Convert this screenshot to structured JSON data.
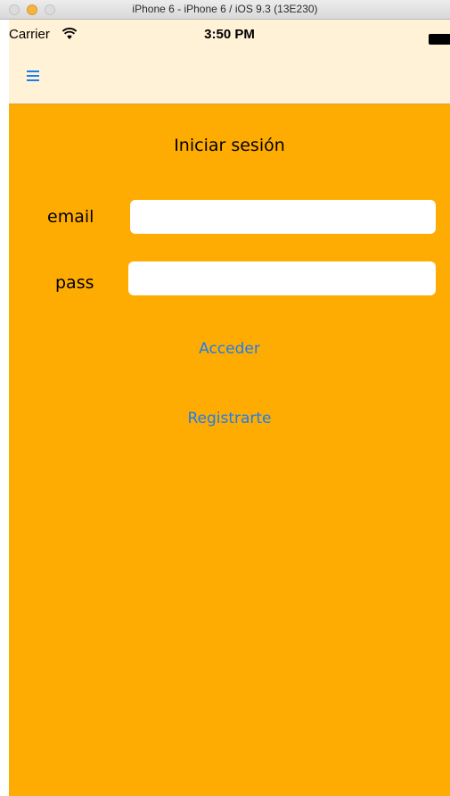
{
  "window": {
    "title": "iPhone 6 - iPhone 6 / iOS 9.3 (13E230)"
  },
  "statusbar": {
    "carrier": "Carrier",
    "time": "3:50 PM"
  },
  "nav": {
    "menu_icon": "hamburger-menu-icon"
  },
  "login": {
    "title": "Iniciar sesión",
    "email_label": "email",
    "email_value": "",
    "pass_label": "pass",
    "pass_value": "",
    "login_button": "Acceder",
    "register_button": "Registrarte"
  },
  "colors": {
    "background": "#ffac02",
    "nav_background": "#fff2d6",
    "accent": "#1a7df2"
  }
}
